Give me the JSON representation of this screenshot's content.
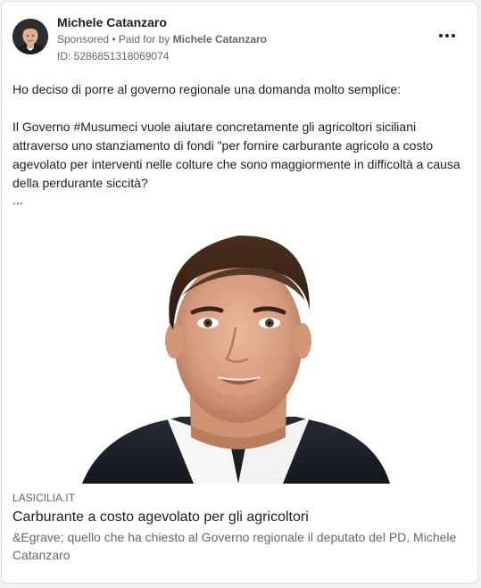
{
  "post": {
    "page_name": "Michele Catanzaro",
    "sponsored_label": "Sponsored",
    "separator": " • ",
    "paid_for_prefix": "Paid for by ",
    "paid_for_name": "Michele Catanzaro",
    "ad_id": "ID: 5286851318069074",
    "body_paragraph_1": "Ho deciso di porre al governo regionale una domanda molto semplice:",
    "body_paragraph_2": "Il Governo #Musumeci vuole aiutare concretamente gli agricoltori siciliani attraverso uno stanziamento di fondi \"per fornire carburante agricolo a costo agevolato per interventi nelle colture che sono maggiormente in difficoltà a causa della perdurante siccità?",
    "see_more": "..."
  },
  "link": {
    "domain": "LASICILIA.IT",
    "title": "Carburante a costo agevolato per gli agricoltori",
    "description": "&Egrave; quello che ha chiesto al Governo regionale il deputato del PD, Michele Catanzaro"
  },
  "icons": {
    "avatar": "profile-photo",
    "more": "more-horizontal-icon",
    "media": "portrait-photo"
  },
  "colors": {
    "text_primary": "#1c1e21",
    "text_secondary": "#65676b",
    "background": "#f0f2f5",
    "card": "#ffffff"
  }
}
